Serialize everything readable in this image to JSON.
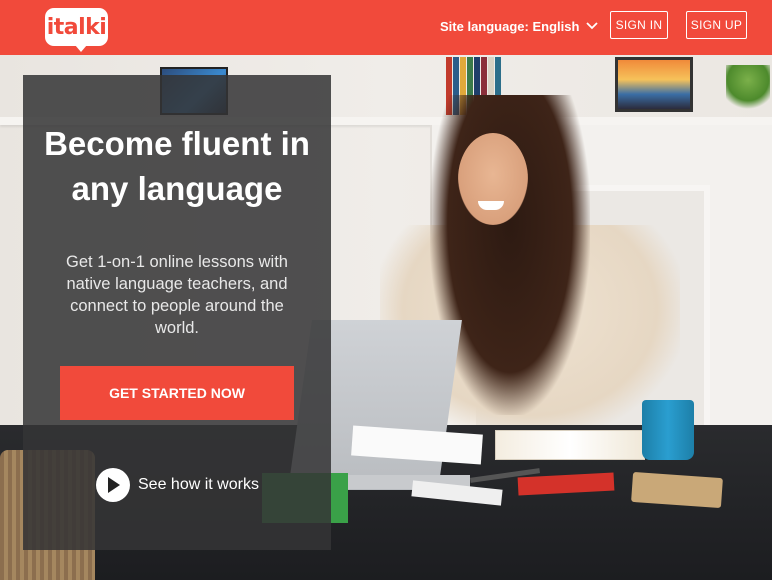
{
  "header": {
    "logo_text": "italki",
    "site_language_label": "Site language: English",
    "signin_label": "SIGN IN",
    "signup_label": "SIGN UP",
    "icons": {
      "language_dropdown": "chevron-down-icon"
    }
  },
  "hero": {
    "headline": "Become fluent in any language",
    "subtext": "Get 1-on-1 online lessons with native language teachers, and connect to people around the world.",
    "cta_label": "GET STARTED NOW",
    "video_link_label": "See how it works",
    "icons": {
      "video": "play-icon"
    }
  },
  "colors": {
    "brand_red": "#f14a3b",
    "panel": "#343436",
    "white": "#ffffff"
  }
}
